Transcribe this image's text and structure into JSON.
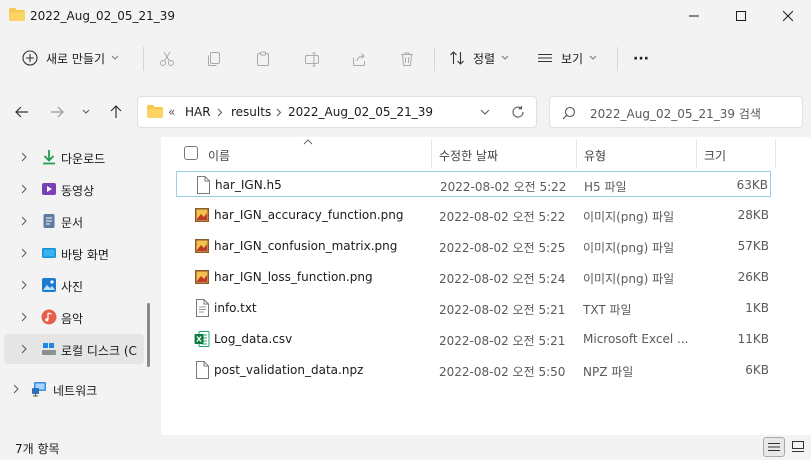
{
  "window": {
    "title": "2022_Aug_02_05_21_39"
  },
  "toolbar": {
    "new_label": "새로 만들기",
    "sort_label": "정렬",
    "view_label": "보기",
    "more_label": "···"
  },
  "address": {
    "overflow": "«",
    "crumbs": [
      "HAR",
      "results",
      "2022_Aug_02_05_21_39"
    ]
  },
  "search": {
    "placeholder": "2022_Aug_02_05_21_39 검색"
  },
  "sidebar": {
    "items": [
      {
        "label": "다운로드",
        "icon": "download-icon"
      },
      {
        "label": "동영상",
        "icon": "video-icon"
      },
      {
        "label": "문서",
        "icon": "document-icon"
      },
      {
        "label": "바탕 화면",
        "icon": "desktop-icon"
      },
      {
        "label": "사진",
        "icon": "picture-icon"
      },
      {
        "label": "음악",
        "icon": "music-icon"
      },
      {
        "label": "로컬 디스크 (C",
        "icon": "drive-icon"
      },
      {
        "label": "네트워크",
        "icon": "network-icon"
      }
    ]
  },
  "columns": {
    "name": "이름",
    "modified": "수정한 날짜",
    "type": "유형",
    "size": "크기"
  },
  "files": [
    {
      "name": "har_IGN.h5",
      "date": "2022-08-02 오전 5:22",
      "type": "H5 파일",
      "size": "63KB",
      "icon": "generic-file-icon"
    },
    {
      "name": "har_IGN_accuracy_function.png",
      "date": "2022-08-02 오전 5:22",
      "type": "이미지(png) 파일",
      "size": "28KB",
      "icon": "image-file-icon"
    },
    {
      "name": "har_IGN_confusion_matrix.png",
      "date": "2022-08-02 오전 5:25",
      "type": "이미지(png) 파일",
      "size": "57KB",
      "icon": "image-file-icon"
    },
    {
      "name": "har_IGN_loss_function.png",
      "date": "2022-08-02 오전 5:24",
      "type": "이미지(png) 파일",
      "size": "26KB",
      "icon": "image-file-icon"
    },
    {
      "name": "info.txt",
      "date": "2022-08-02 오전 5:21",
      "type": "TXT 파일",
      "size": "1KB",
      "icon": "text-file-icon"
    },
    {
      "name": "Log_data.csv",
      "date": "2022-08-02 오전 5:21",
      "type": "Microsoft Excel ...",
      "size": "11KB",
      "icon": "excel-file-icon"
    },
    {
      "name": "post_validation_data.npz",
      "date": "2022-08-02 오전 5:50",
      "type": "NPZ 파일",
      "size": "6KB",
      "icon": "generic-file-icon"
    }
  ],
  "status": {
    "count": "7개 항목"
  },
  "colors": {
    "accent": "#0067c0",
    "selection_border": "#99d1e8",
    "folder": "#f8c74b"
  }
}
